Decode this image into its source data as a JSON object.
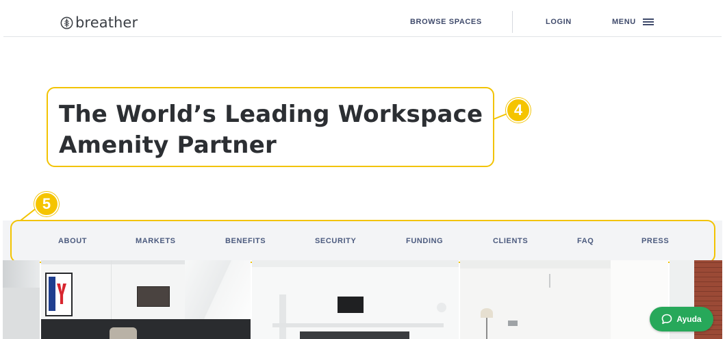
{
  "header": {
    "logo_text": "breather",
    "logo_icon": "leaf-circle-icon",
    "nav": {
      "browse": "BROWSE SPACES",
      "login": "LOGIN",
      "menu": "MENU"
    }
  },
  "hero": {
    "headline_line1": "The World’s Leading Workspace",
    "headline_line2": "Amenity Partner"
  },
  "callouts": {
    "headline_num": "4",
    "subnav_num": "5",
    "color": "#f2c300"
  },
  "subnav": {
    "items": [
      {
        "label": "ABOUT"
      },
      {
        "label": "MARKETS"
      },
      {
        "label": "BENEFITS"
      },
      {
        "label": "SECURITY"
      },
      {
        "label": "FUNDING"
      },
      {
        "label": "CLIENTS"
      },
      {
        "label": "FAQ"
      },
      {
        "label": "PRESS"
      }
    ]
  },
  "chat": {
    "label": "Ayuda",
    "icon": "chat-bubble-icon",
    "color": "#27a85a"
  },
  "colors": {
    "nav_text": "#3f4a6b",
    "subnav_bg": "#f3f4f6",
    "headline": "#2c2f33"
  }
}
